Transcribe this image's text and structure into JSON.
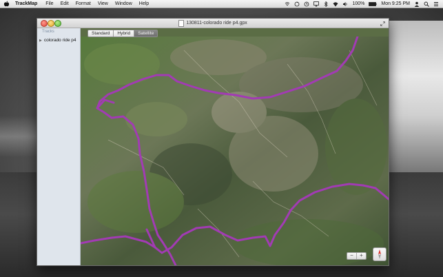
{
  "menubar": {
    "app_name": "TrackMap",
    "menus": [
      "File",
      "Edit",
      "Format",
      "View",
      "Window",
      "Help"
    ],
    "battery": "100%",
    "clock": "Mon 9:25 PM",
    "icons": [
      "wifi-icon",
      "sync-icon",
      "clock-icon",
      "airplay-icon",
      "bluetooth-icon",
      "wifi-signal-icon",
      "volume-icon",
      "battery-icon",
      "user-icon",
      "spotlight-icon",
      "notifications-icon"
    ]
  },
  "window": {
    "title": "130811-colorado ride p4.gpx"
  },
  "sidebar": {
    "header": "Tracks",
    "items": [
      {
        "label": "colorado ride p4",
        "expanded": false
      }
    ]
  },
  "map_modes": {
    "options": [
      "Standard",
      "Hybrid",
      "Satellite"
    ],
    "selected": "Satellite"
  },
  "zoom": {
    "out_label": "−",
    "in_label": "+"
  },
  "colors": {
    "track": "#a23bb4",
    "accent": "#6e6e6e"
  }
}
